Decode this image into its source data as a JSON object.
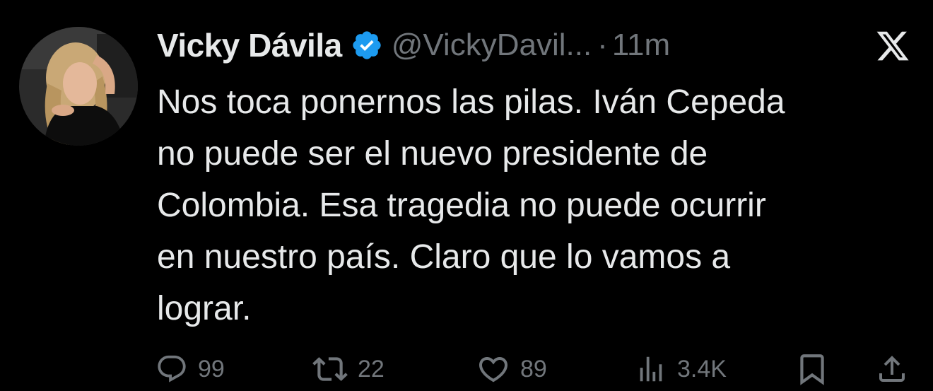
{
  "author": {
    "display_name": "Vicky Dávila",
    "handle": "@VickyDavil...",
    "separator": "·",
    "timestamp": "11m",
    "verified": true
  },
  "tweet": {
    "text": "Nos toca ponernos las pilas. Iván Cepeda\nno puede ser el nuevo presidente de\nColombia. Esa tragedia no puede ocurrir\nen nuestro país. Claro que lo vamos a\nlograr."
  },
  "actions": {
    "replies": "99",
    "reposts": "22",
    "likes": "89",
    "views": "3.4K"
  },
  "icons": {
    "reply": "reply-icon",
    "repost": "repost-icon",
    "like": "heart-icon",
    "views": "views-icon",
    "bookmark": "bookmark-icon",
    "share": "share-icon",
    "platform": "x-logo-icon",
    "verified": "verified-badge-icon"
  },
  "colors": {
    "background": "#000000",
    "text_primary": "#e7e9ea",
    "text_secondary": "#71767b",
    "verified_blue": "#1d9bf0"
  }
}
